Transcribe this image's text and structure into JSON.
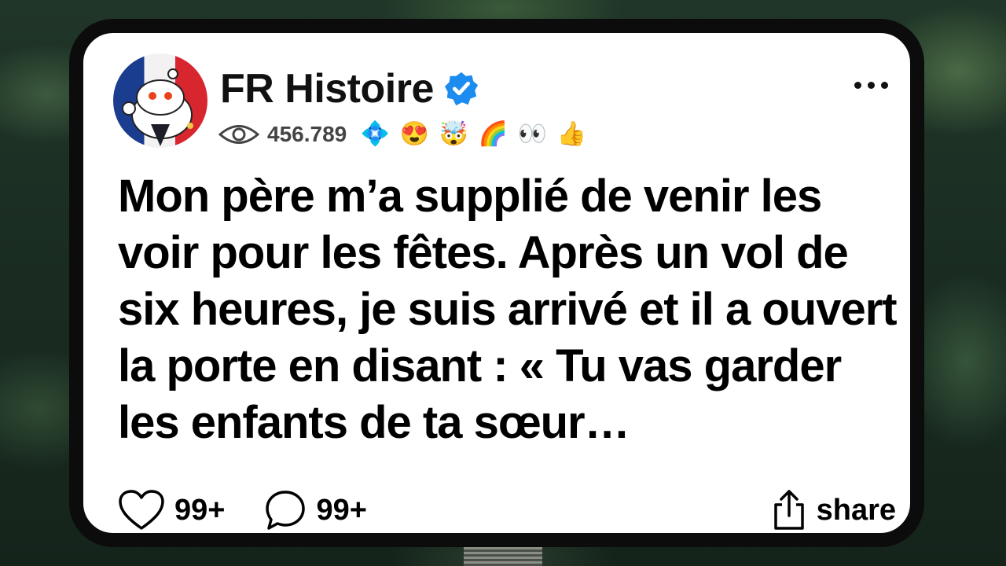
{
  "post": {
    "title": "FR Histoire",
    "views": "456.789",
    "badges": [
      "💠",
      "😍",
      "🤯",
      "🌈",
      "👀",
      "👍"
    ],
    "body": "Mon père m’a supplié de venir les voir pour les fêtes. Après un vol de six heures, je suis arrivé et il a ouvert la porte en disant : « Tu vas garder les enfants de ta sœur…",
    "likes": "99+",
    "comments": "99+",
    "share_label": "share"
  },
  "colors": {
    "verified": "#1d8cf0",
    "card_border": "#0c0c0c",
    "background": "#1c3024"
  }
}
